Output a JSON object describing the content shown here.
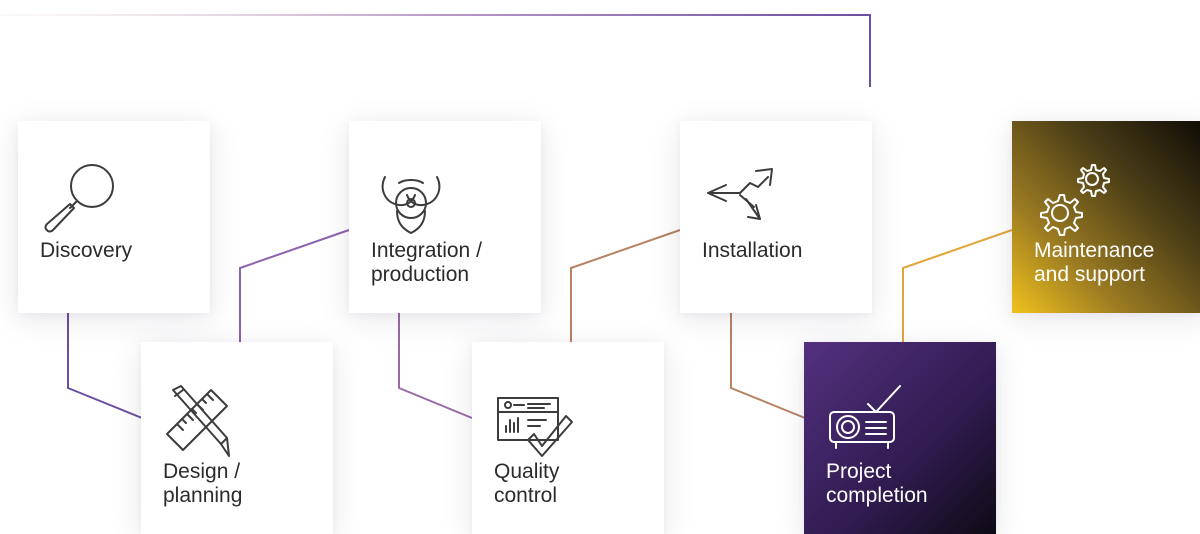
{
  "colors": {
    "purple_line": "#6b4fa3",
    "violet_line": "#8d63b0",
    "copper_line": "#b98262",
    "gold_line": "#e2a53a",
    "icon_stroke": "#3c3c3c",
    "dark_purple": "#3b2260",
    "gold": "#f0c21d"
  },
  "steps": [
    {
      "label": "Discovery",
      "icon": "magnifier-icon",
      "style": "light"
    },
    {
      "label": "Design /\nplanning",
      "icon": "ruler-pencil-icon",
      "style": "light"
    },
    {
      "label": "Integration /\nproduction",
      "icon": "interlocking-circles-icon",
      "style": "light"
    },
    {
      "label": "Quality\ncontrol",
      "icon": "checklist-check-icon",
      "style": "light"
    },
    {
      "label": "Installation",
      "icon": "arrows-icon",
      "style": "light"
    },
    {
      "label": "Project\ncompletion",
      "icon": "projector-check-icon",
      "style": "dark-purple"
    },
    {
      "label": "Maintenance\nand support",
      "icon": "gears-icon",
      "style": "gold"
    }
  ]
}
